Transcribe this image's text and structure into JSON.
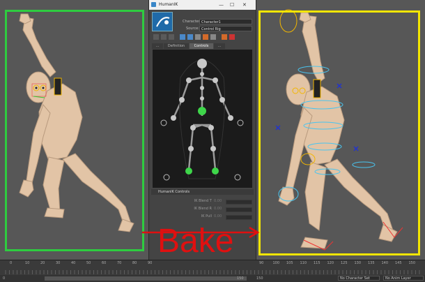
{
  "window": {
    "title": "HumanIK",
    "controls": [
      "—",
      "☐",
      "✕"
    ]
  },
  "hik": {
    "character_label": "Character:",
    "character_value": "Character1",
    "source_label": "Source:",
    "source_value": "Control Rig",
    "tabs": [
      "...",
      "Definition",
      "Controls",
      "..."
    ],
    "controls_header": "HumanIK Controls",
    "sliders": [
      {
        "label": "IK Blend T",
        "value": "0.00"
      },
      {
        "label": "IK Blend R",
        "value": "0.00"
      },
      {
        "label": "IK Pull",
        "value": "0.00"
      }
    ]
  },
  "timeline": {
    "ticks_left": [
      "0",
      "10",
      "20",
      "30",
      "40",
      "50",
      "60",
      "70",
      "80",
      "90"
    ],
    "ticks_right": [
      "90",
      "100",
      "105",
      "110",
      "115",
      "120",
      "125",
      "130",
      "135",
      "140",
      "145",
      "150"
    ],
    "start": "0",
    "end": "150",
    "current": "150",
    "character_set": "No Character Set",
    "anim_layer": "No Anim Layer"
  },
  "annotation": {
    "text": "Bake"
  },
  "colors": {
    "green_frame": "#2ecc40",
    "yellow_frame": "#f3e600",
    "arrow": "#e01010",
    "skin": "#e2c4a6"
  }
}
